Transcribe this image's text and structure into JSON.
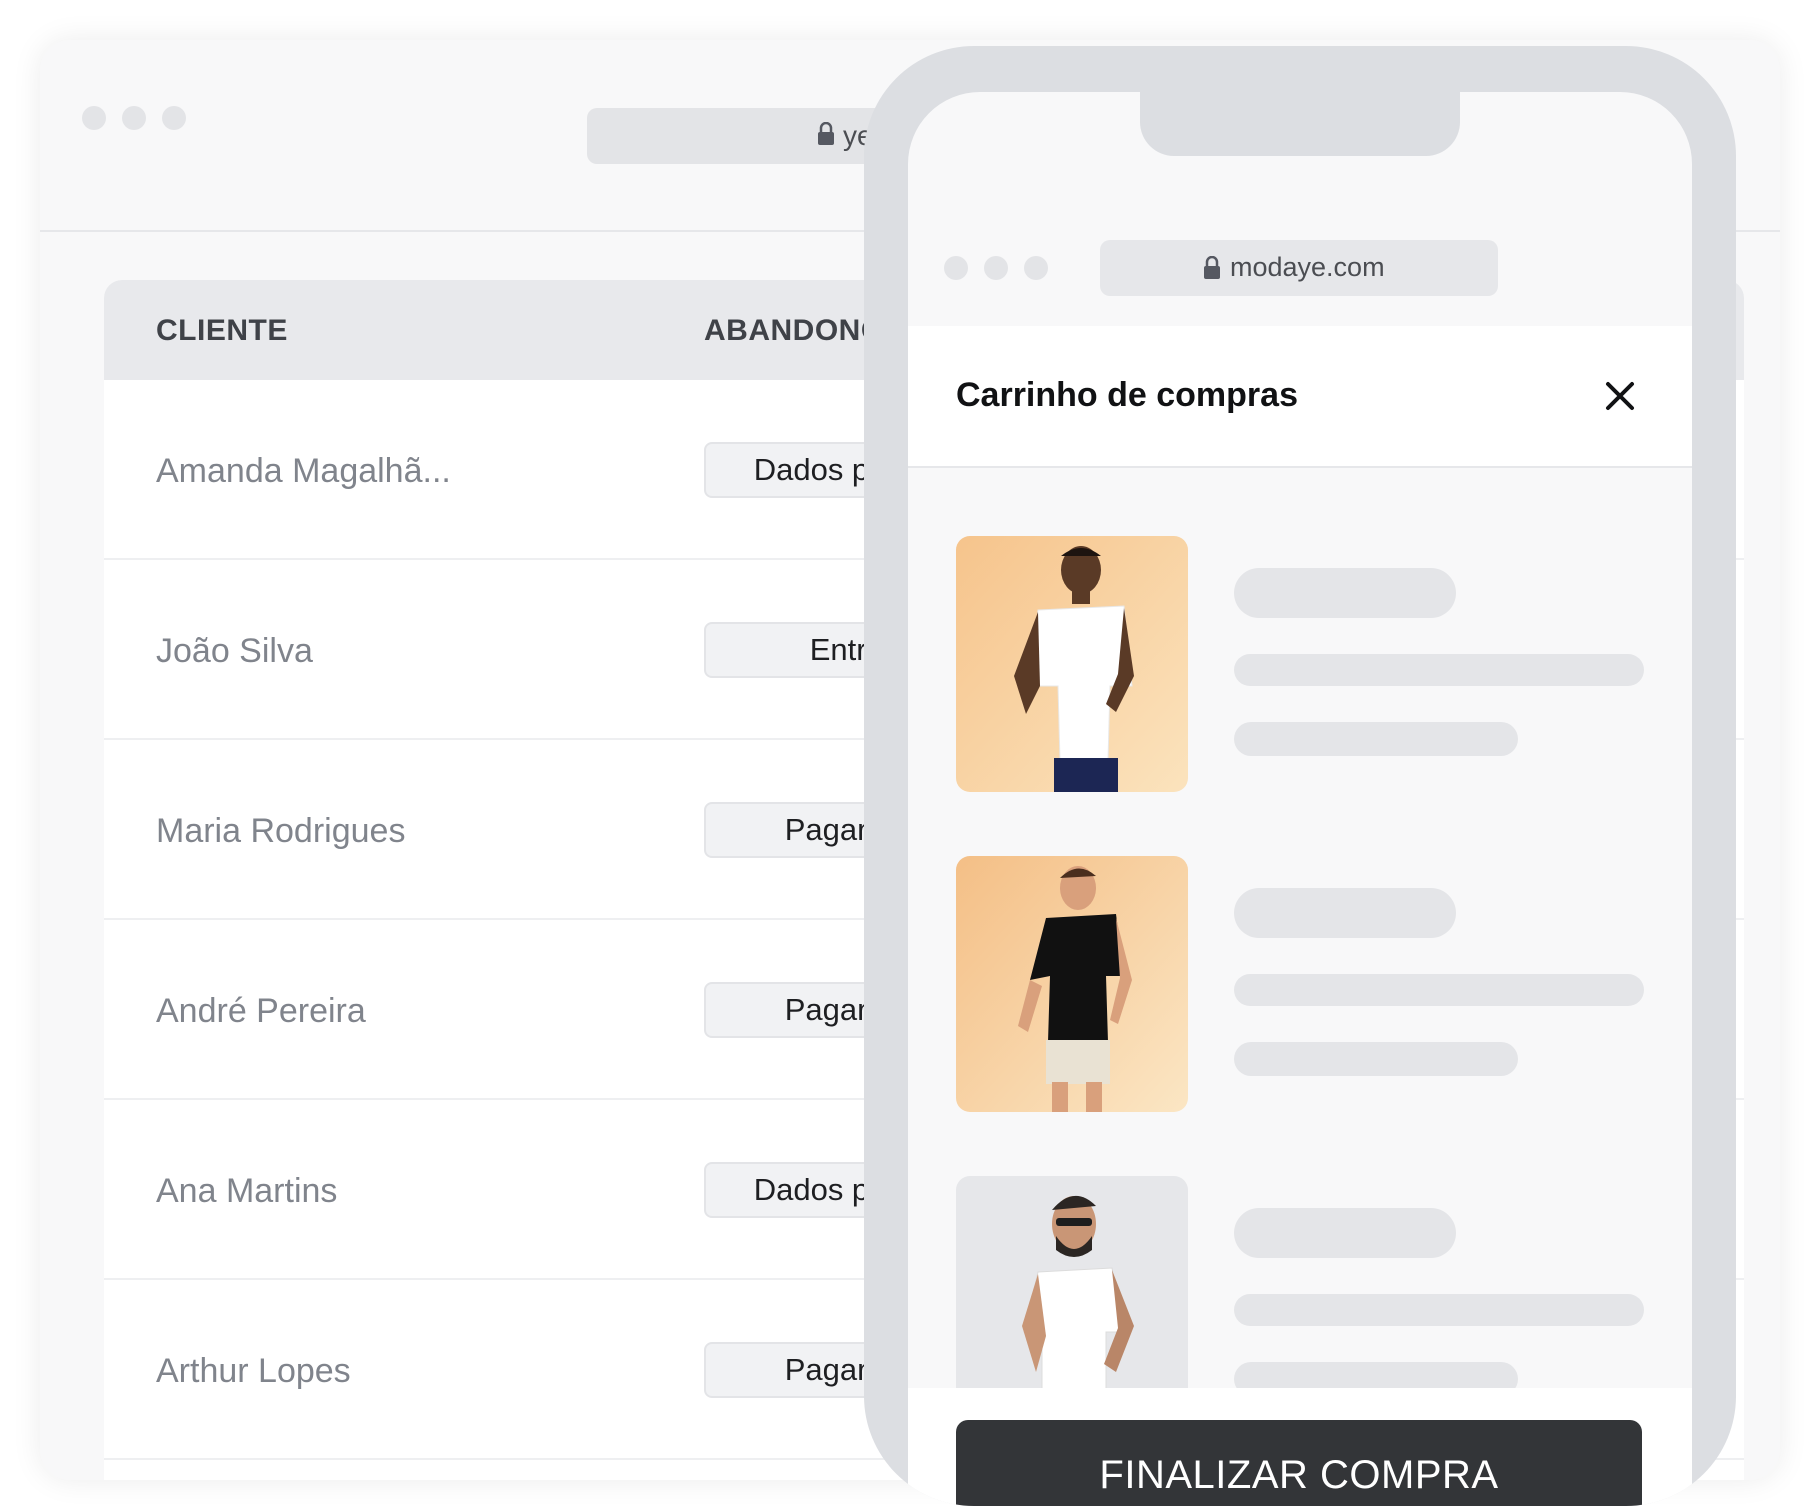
{
  "desktop": {
    "url_fragment": "ye",
    "table": {
      "headers": {
        "client": "CLIENTE",
        "abandonment": "ABANDONO"
      },
      "rows": [
        {
          "client": "Amanda Magalhã...",
          "step": "Dados pessoais"
        },
        {
          "client": "João Silva",
          "step": "Entrega"
        },
        {
          "client": "Maria Rodrigues",
          "step": "Pagamento"
        },
        {
          "client": "André Pereira",
          "step": "Pagamento"
        },
        {
          "client": "Ana Martins",
          "step": "Dados pessoais"
        },
        {
          "client": "Arthur Lopes",
          "step": "Pagamento"
        }
      ]
    }
  },
  "phone": {
    "url": "modaye.com",
    "cart": {
      "title": "Carrinho de compras",
      "checkout_label": "FINALIZAR COMPRA",
      "items": [
        {
          "image": "man-white-shirt-navy-pants"
        },
        {
          "image": "man-black-shirt-white-shorts"
        },
        {
          "image": "man-white-shirt-tattoos"
        }
      ]
    }
  },
  "colors": {
    "window_bg": "#f8f8f9",
    "header_bg": "#e8e9ec",
    "phone_frame": "#dcdee2",
    "button_dark": "#333538",
    "product_bg_warm": "#f6c68c",
    "product_bg_gray": "#e6e7ea"
  }
}
